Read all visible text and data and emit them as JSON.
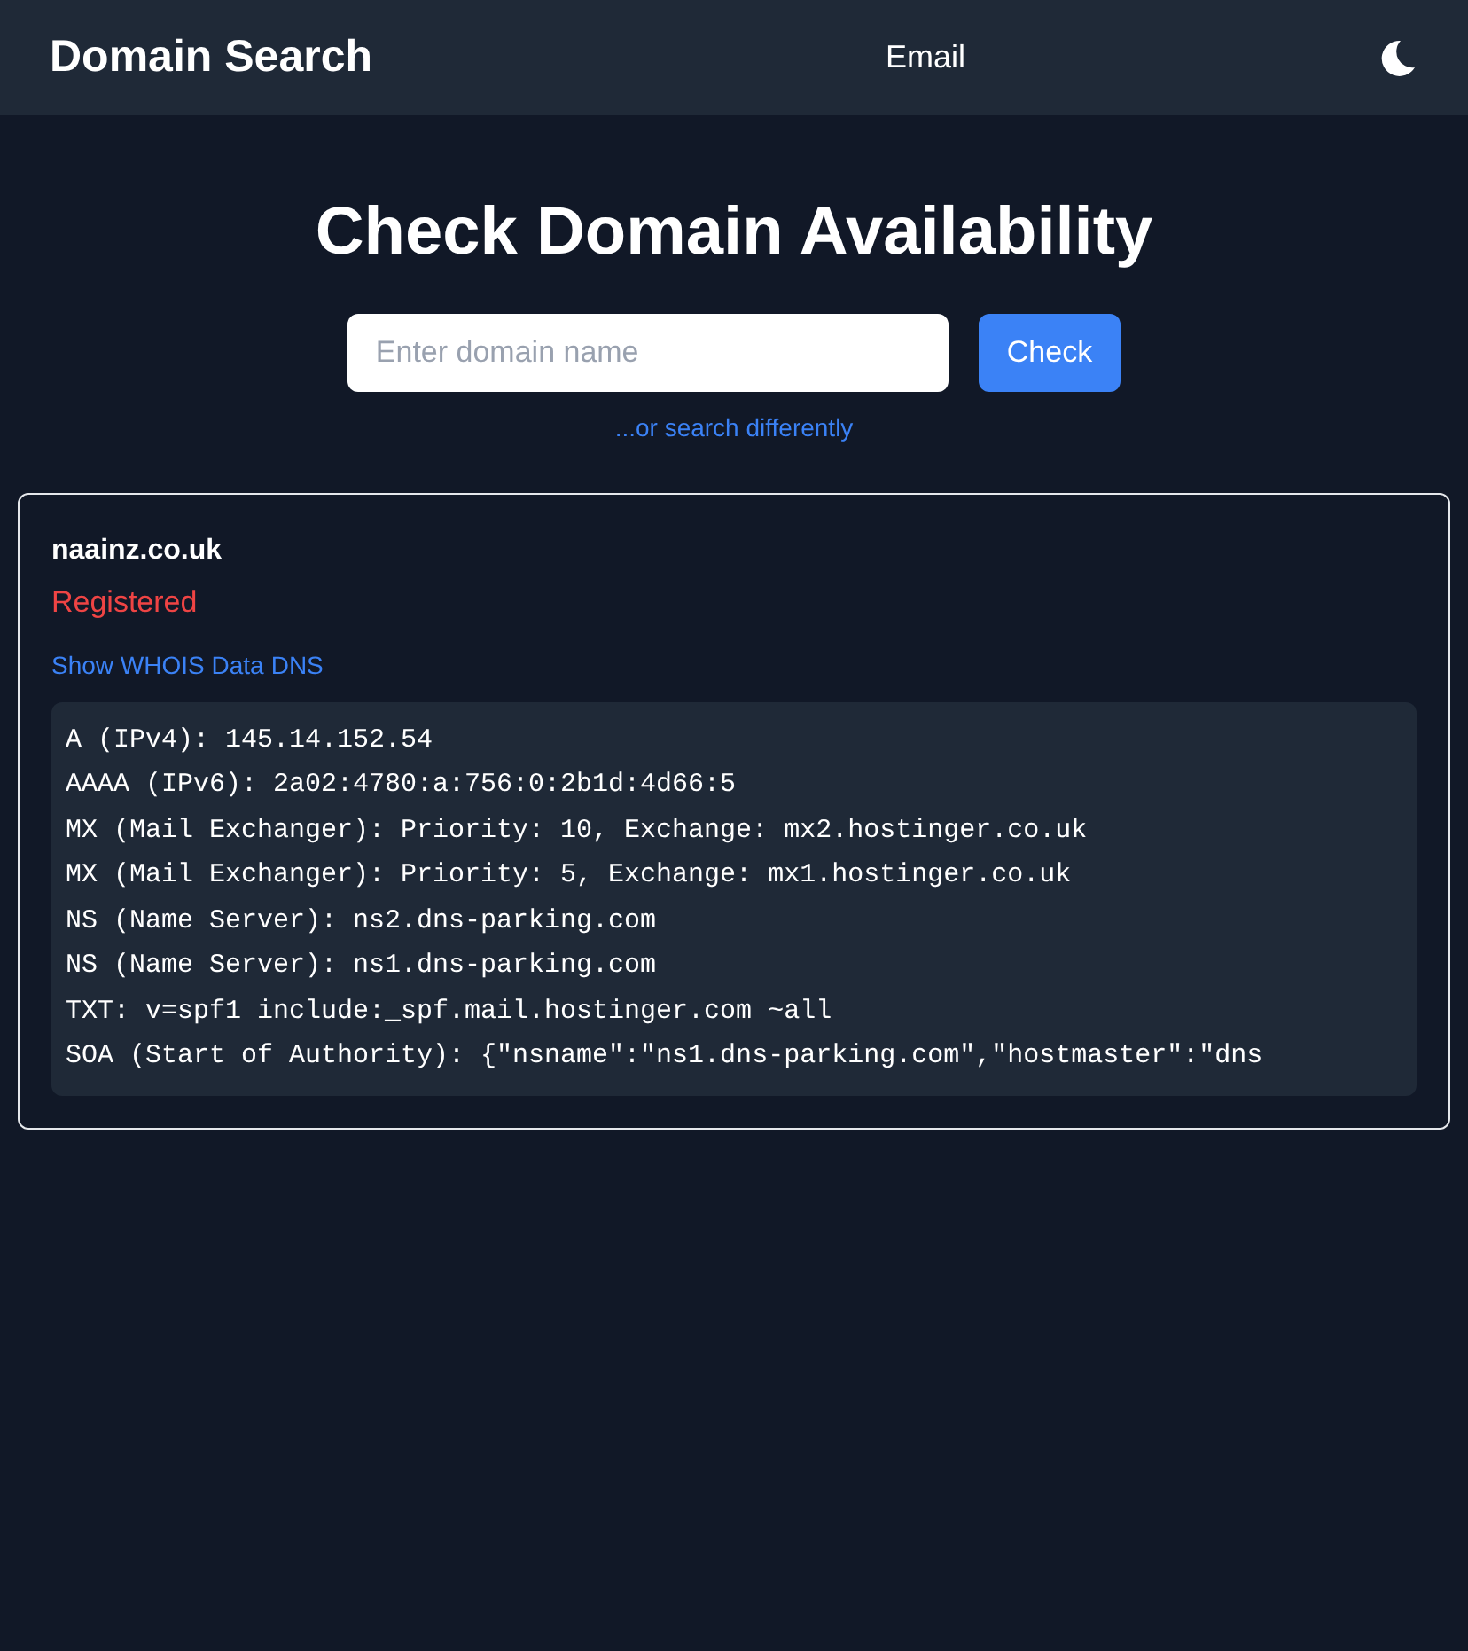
{
  "header": {
    "title": "Domain Search",
    "nav_link": "Email"
  },
  "hero": {
    "title": "Check Domain Availability",
    "search": {
      "placeholder": "Enter domain name"
    },
    "button": "Check",
    "alt_link": "...or search differently"
  },
  "result": {
    "domain": "naainz.co.uk",
    "status": "Registered",
    "registered": true,
    "links": [
      "Show WHOIS Data",
      "DNS"
    ],
    "dns_records": [
      "A (IPv4): 145.14.152.54",
      "AAAA (IPv6): 2a02:4780:a:756:0:2b1d:4d66:5",
      "MX (Mail Exchanger): Priority: 10, Exchange: mx2.hostinger.co.uk",
      "MX (Mail Exchanger): Priority: 5, Exchange: mx1.hostinger.co.uk",
      "NS (Name Server): ns2.dns-parking.com",
      "NS (Name Server): ns1.dns-parking.com",
      "TXT: v=spf1 include:_spf.mail.hostinger.com ~all",
      "SOA (Start of Authority): {\"nsname\":\"ns1.dns-parking.com\",\"hostmaster\":\"dns"
    ]
  }
}
